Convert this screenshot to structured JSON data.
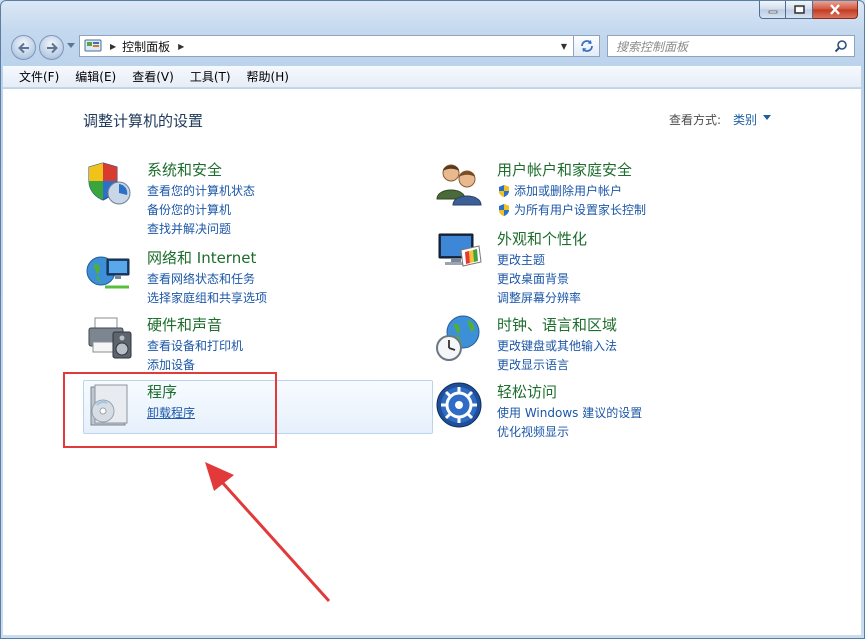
{
  "window": {
    "caption_buttons": [
      "minimize-icon",
      "maximize-icon",
      "close-icon"
    ]
  },
  "nav": {
    "address_path": "控制面板",
    "search_placeholder": "搜索控制面板"
  },
  "menu": {
    "items": [
      "文件(F)",
      "编辑(E)",
      "查看(V)",
      "工具(T)",
      "帮助(H)"
    ]
  },
  "main": {
    "title": "调整计算机的设置",
    "view_by_label": "查看方式:",
    "view_by_value": "类别"
  },
  "categories": {
    "system_security": {
      "title": "系统和安全",
      "icon": "shield-icon",
      "links": [
        "查看您的计算机状态",
        "备份您的计算机",
        "查找并解决问题"
      ]
    },
    "network": {
      "title": "网络和 Internet",
      "icon": "network-globe-icon",
      "links": [
        "查看网络状态和任务",
        "选择家庭组和共享选项"
      ]
    },
    "hardware_sound": {
      "title": "硬件和声音",
      "icon": "printer-icon",
      "links": [
        "查看设备和打印机",
        "添加设备"
      ]
    },
    "programs": {
      "title": "程序",
      "icon": "programs-disc-icon",
      "links": [
        "卸载程序"
      ]
    },
    "user_accounts": {
      "title": "用户帐户和家庭安全",
      "icon": "users-icon",
      "links": [
        "添加或删除用户帐户",
        "为所有用户设置家长控制"
      ]
    },
    "appearance": {
      "title": "外观和个性化",
      "icon": "monitor-palette-icon",
      "links": [
        "更改主题",
        "更改桌面背景",
        "调整屏幕分辨率"
      ]
    },
    "clock_region": {
      "title": "时钟、语言和区域",
      "icon": "clock-globe-icon",
      "links": [
        "更改键盘或其他输入法",
        "更改显示语言"
      ]
    },
    "ease_access": {
      "title": "轻松访问",
      "icon": "ease-of-access-icon",
      "links": [
        "使用 Windows 建议的设置",
        "优化视频显示"
      ]
    }
  },
  "colors": {
    "category_title": "#1d6d2c",
    "link": "#1c57a8",
    "annotation": "#e23a3a"
  }
}
